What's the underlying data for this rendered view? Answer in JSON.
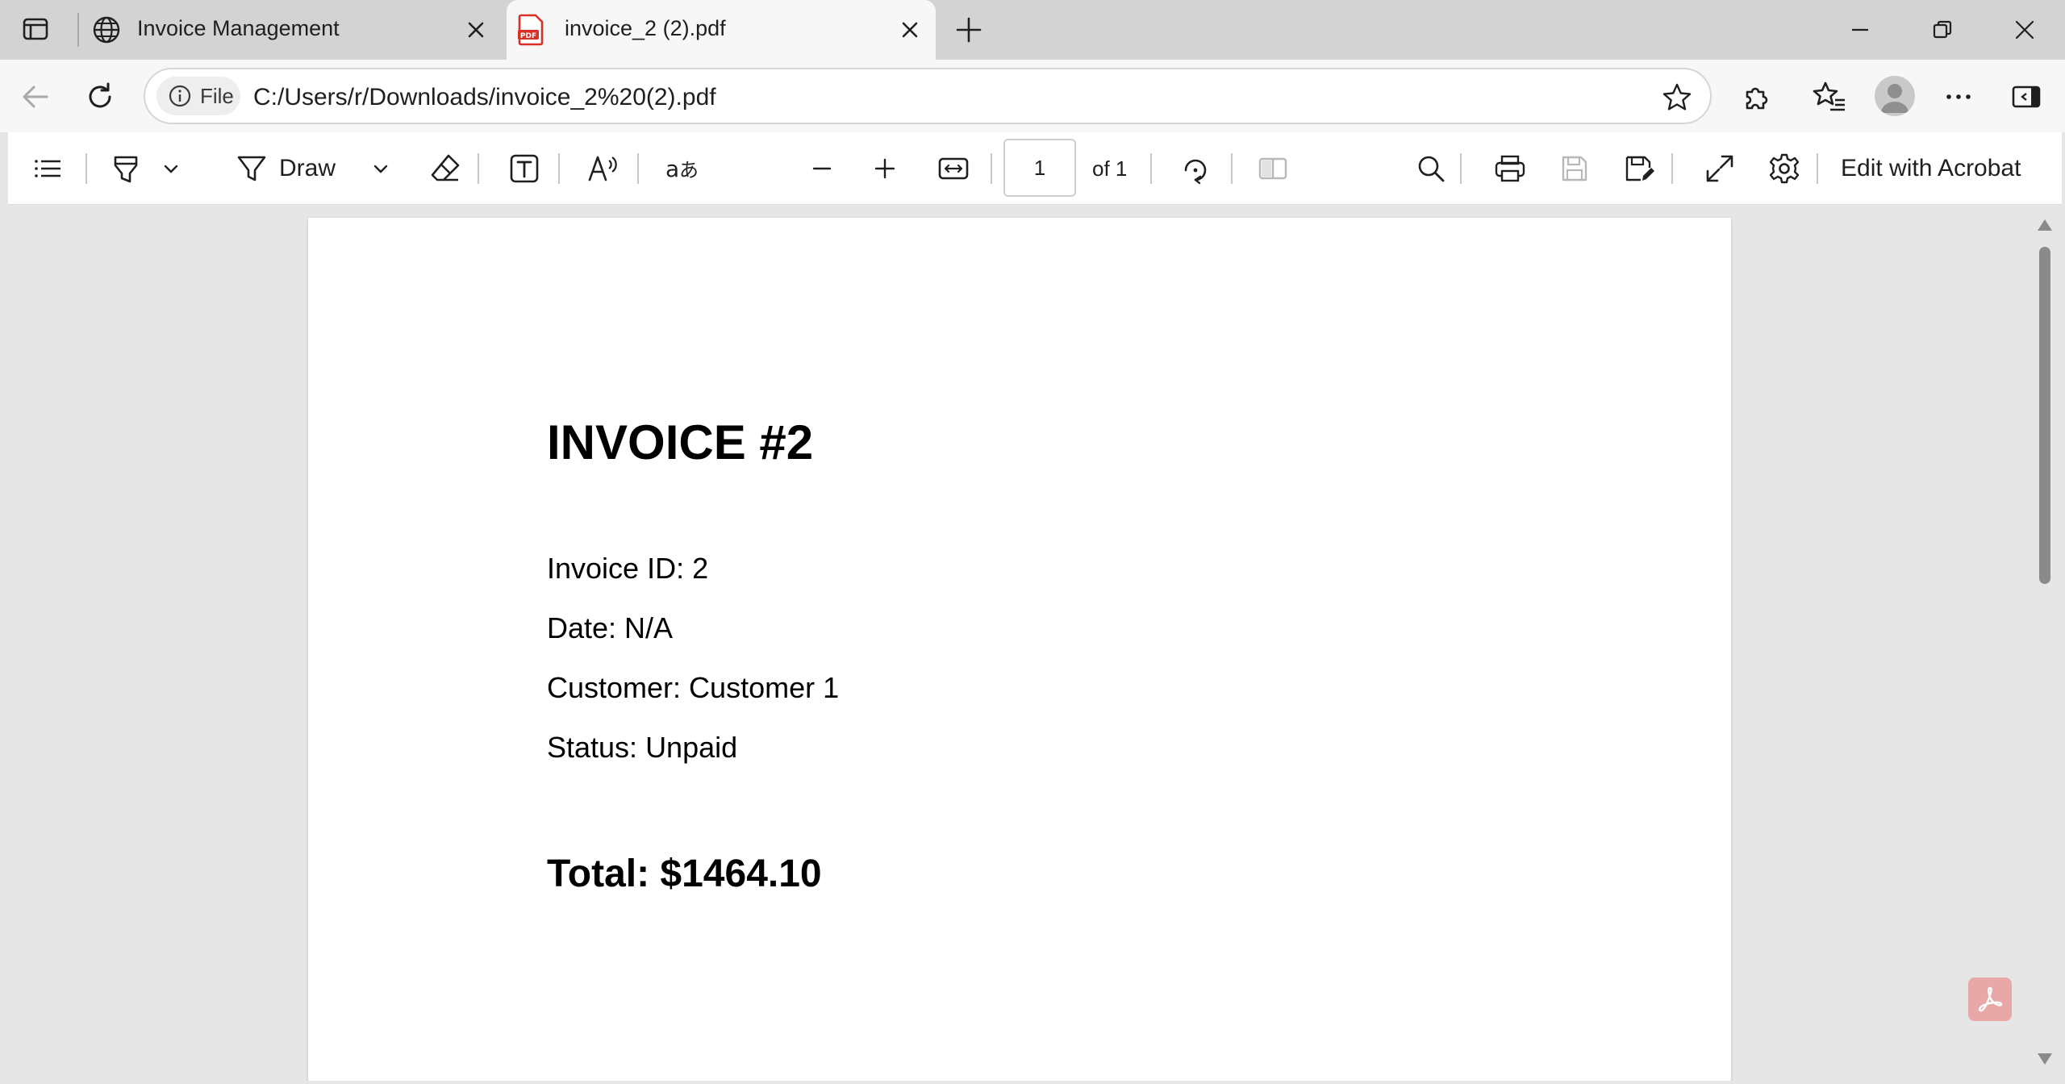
{
  "tabs": [
    {
      "title": "Invoice Management",
      "icon": "globe-icon",
      "active": false
    },
    {
      "title": "invoice_2 (2).pdf",
      "icon": "pdf-file-icon",
      "active": true
    }
  ],
  "address_bar": {
    "site_info_label": "File",
    "url": "C:/Users/r/Downloads/invoice_2%20(2).pdf"
  },
  "pdf_toolbar": {
    "draw_label": "Draw",
    "page_current": "1",
    "page_of": "of 1",
    "edit_label": "Edit with Acrobat"
  },
  "document": {
    "title": "INVOICE #2",
    "lines": {
      "invoice_id": "Invoice ID: 2",
      "date": "Date: N/A",
      "customer": "Customer: Customer 1",
      "status": "Status: Unpaid"
    },
    "total": "Total: $1464.10"
  },
  "colors": {
    "tabstrip_bg": "#d3d3d3",
    "toolbar_bg": "#f7f7f7",
    "viewer_bg": "#e6e6e6",
    "pdf_icon_red": "#d93025",
    "acrobat_fab": "#e8a8a8"
  }
}
